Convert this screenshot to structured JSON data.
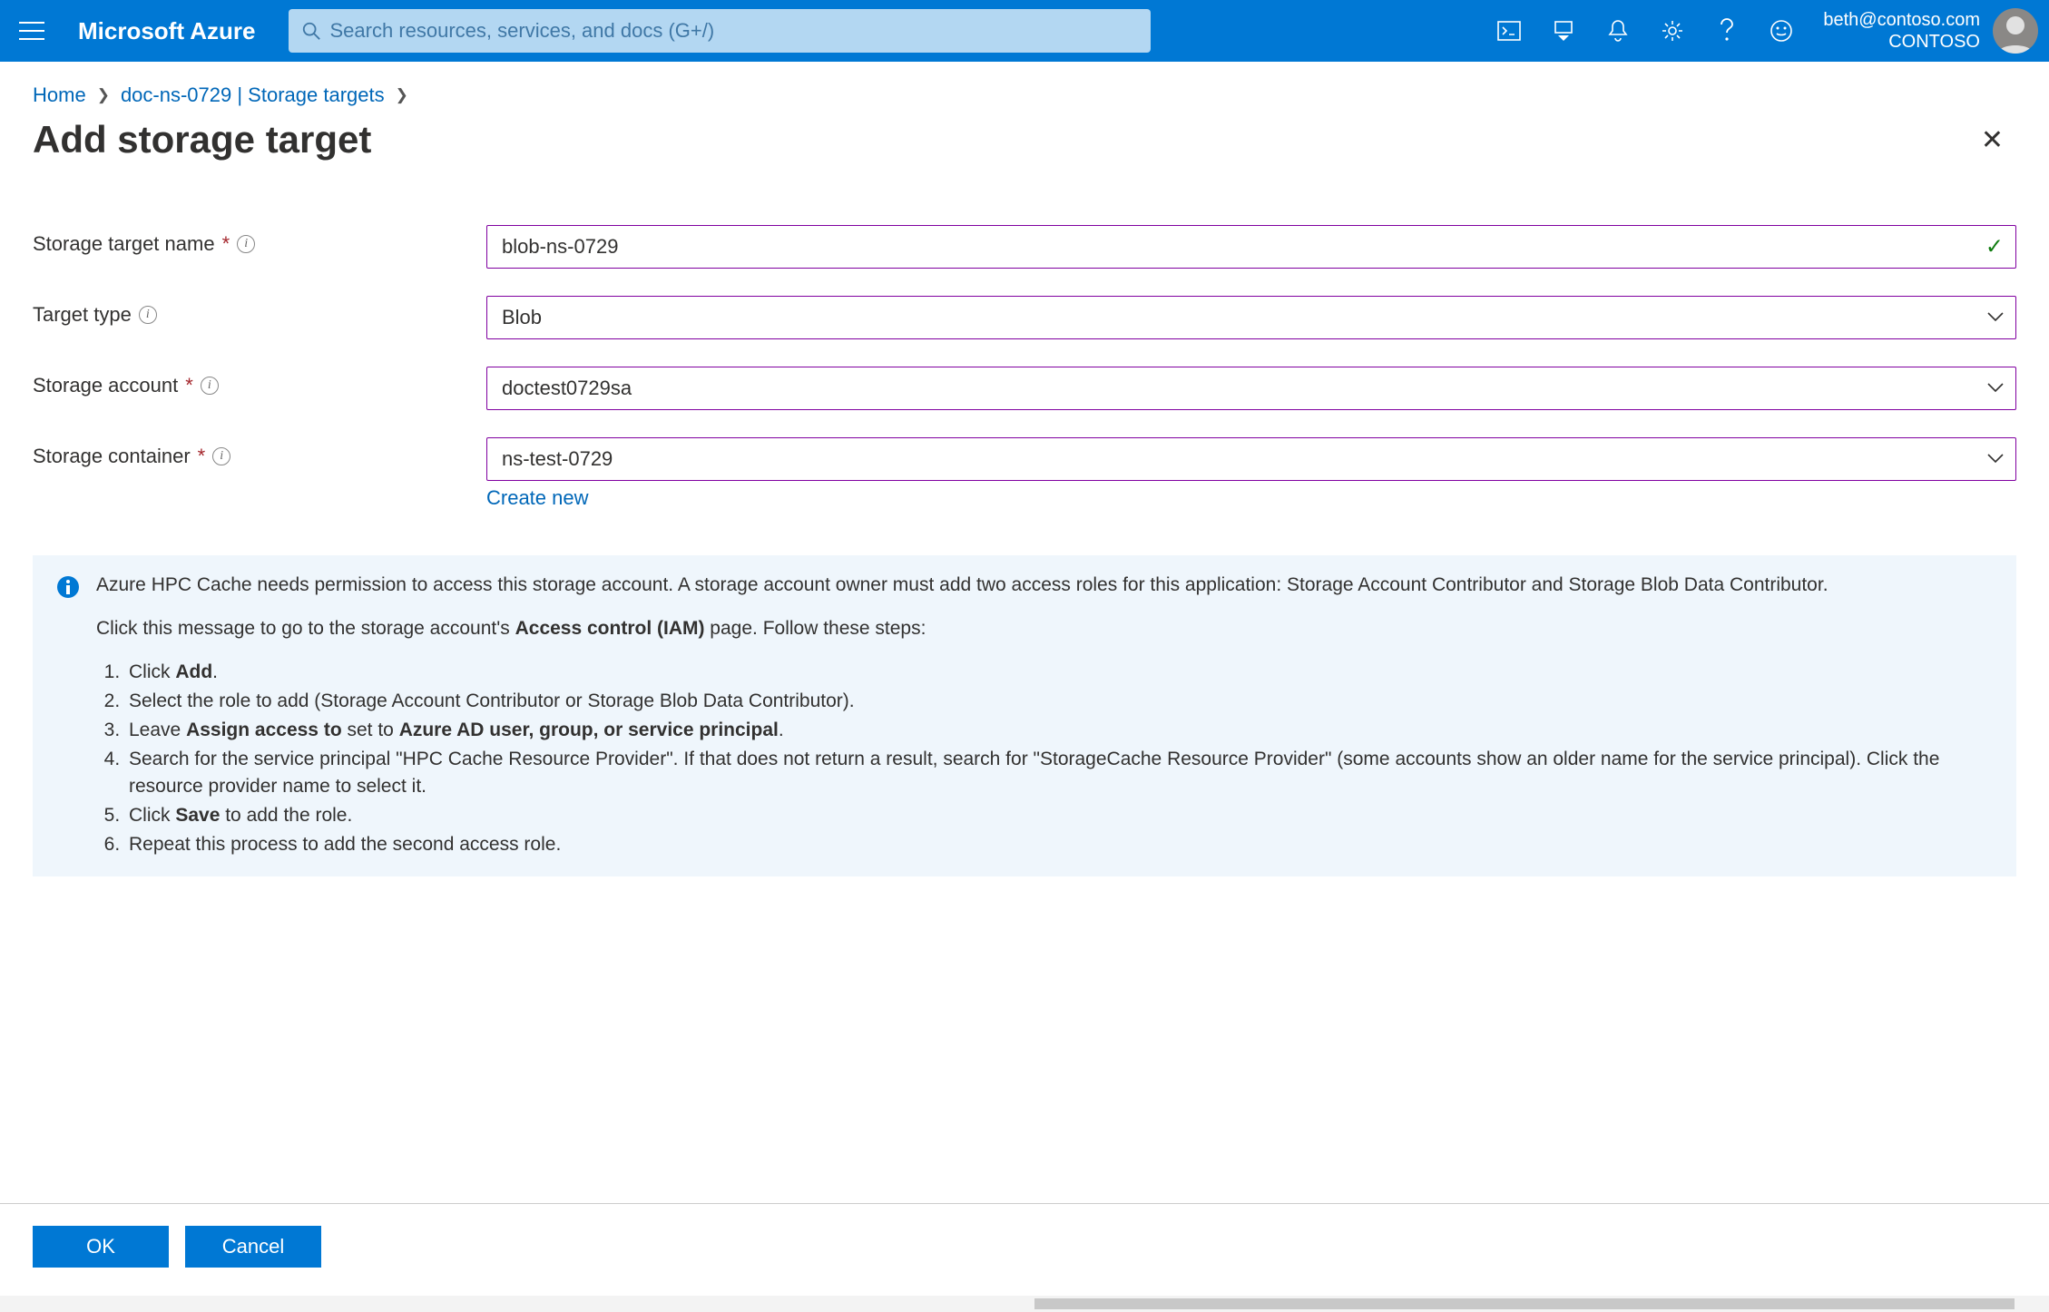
{
  "header": {
    "brand": "Microsoft Azure",
    "search_placeholder": "Search resources, services, and docs (G+/)",
    "account_email": "beth@contoso.com",
    "account_org": "CONTOSO"
  },
  "breadcrumb": {
    "home": "Home",
    "item": "doc-ns-0729 | Storage targets"
  },
  "page": {
    "title": "Add storage target"
  },
  "form": {
    "storage_target_name": {
      "label": "Storage target name",
      "value": "blob-ns-0729",
      "required": true
    },
    "target_type": {
      "label": "Target type",
      "value": "Blob",
      "required": false
    },
    "storage_account": {
      "label": "Storage account",
      "value": "doctest0729sa",
      "required": true
    },
    "storage_container": {
      "label": "Storage container",
      "value": "ns-test-0729",
      "required": true
    },
    "create_new": "Create new"
  },
  "info": {
    "para1": "Azure HPC Cache needs permission to access this storage account. A storage account owner must add two access roles for this application: Storage Account Contributor and Storage Blob Data Contributor.",
    "para2_pre": "Click this message to go to the storage account's ",
    "para2_bold": "Access control (IAM)",
    "para2_post": " page. Follow these steps:",
    "steps": {
      "s1_pre": "Click ",
      "s1_b": "Add",
      "s1_post": ".",
      "s2": "Select the role to add (Storage Account Contributor or Storage Blob Data Contributor).",
      "s3_pre": "Leave ",
      "s3_b1": "Assign access to",
      "s3_mid": " set to ",
      "s3_b2": "Azure AD user, group, or service principal",
      "s3_post": ".",
      "s4": "Search for the service principal \"HPC Cache Resource Provider\". If that does not return a result, search for \"StorageCache Resource Provider\" (some accounts show an older name for the service principal). Click the resource provider name to select it.",
      "s5_pre": "Click ",
      "s5_b": "Save",
      "s5_post": " to add the role.",
      "s6": "Repeat this process to add the second access role."
    }
  },
  "footer": {
    "ok": "OK",
    "cancel": "Cancel"
  }
}
